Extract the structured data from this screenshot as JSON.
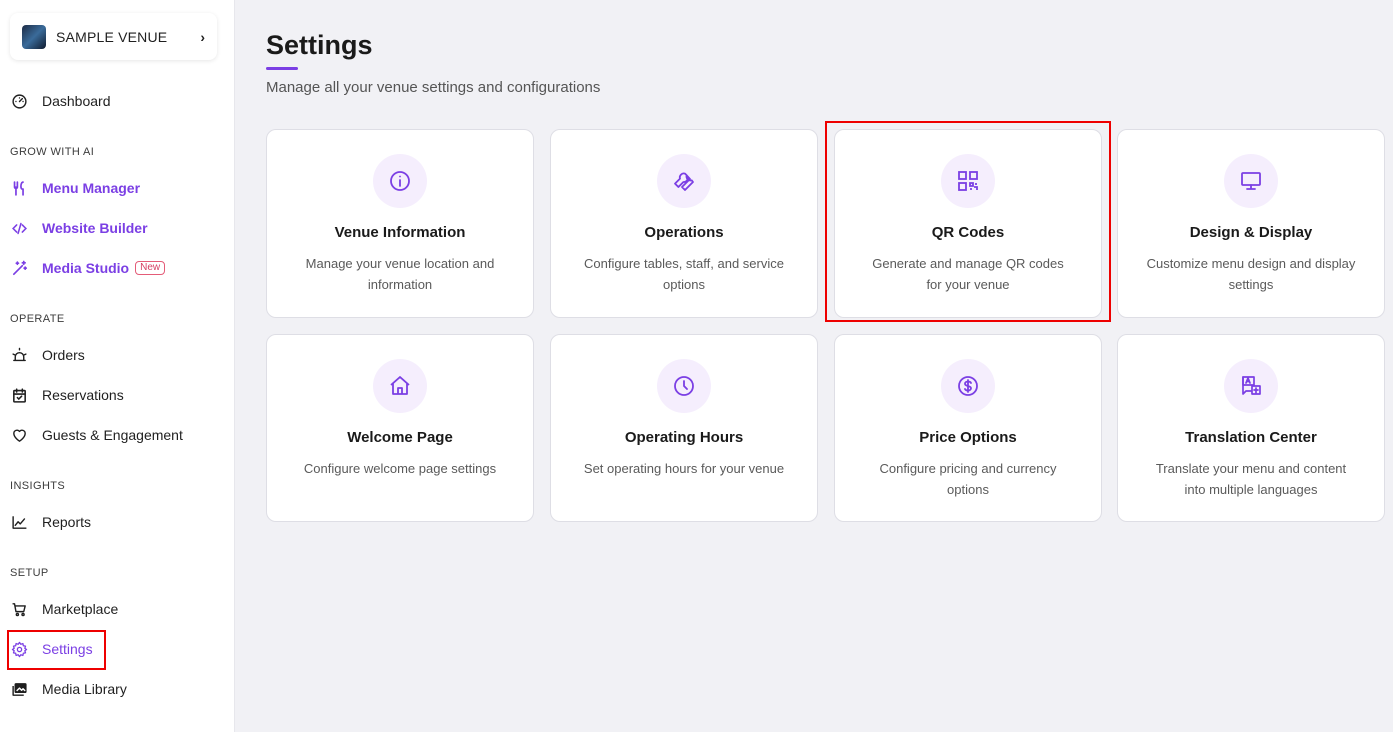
{
  "venue": {
    "name": "SAMPLE VENUE",
    "chevron": "›"
  },
  "sidebar": {
    "dashboard": "Dashboard",
    "sections": {
      "grow": "GROW WITH AI",
      "operate": "OPERATE",
      "insights": "INSIGHTS",
      "setup": "SETUP"
    },
    "grow_items": [
      {
        "label": "Menu Manager",
        "icon": "fork-knife-icon"
      },
      {
        "label": "Website Builder",
        "icon": "code-icon"
      },
      {
        "label": "Media Studio",
        "icon": "magic-wand-icon",
        "badge": "New"
      }
    ],
    "operate_items": [
      {
        "label": "Orders",
        "icon": "bell-icon"
      },
      {
        "label": "Reservations",
        "icon": "calendar-check-icon"
      },
      {
        "label": "Guests & Engagement",
        "icon": "heart-icon"
      }
    ],
    "insights_items": [
      {
        "label": "Reports",
        "icon": "line-chart-icon"
      }
    ],
    "setup_items": [
      {
        "label": "Marketplace",
        "icon": "cart-icon"
      },
      {
        "label": "Settings",
        "icon": "gear-icon",
        "active": true
      },
      {
        "label": "Media Library",
        "icon": "images-icon"
      }
    ]
  },
  "main": {
    "title": "Settings",
    "subtitle": "Manage all your venue settings and configurations",
    "cards": [
      {
        "title": "Venue Information",
        "desc": "Manage your venue location and information",
        "icon": "info-icon"
      },
      {
        "title": "Operations",
        "desc": "Configure tables, staff, and service options",
        "icon": "wrench-icon"
      },
      {
        "title": "QR Codes",
        "desc": "Generate and manage QR codes for your venue",
        "icon": "qr-code-icon"
      },
      {
        "title": "Design & Display",
        "desc": "Customize menu design and display settings",
        "icon": "monitor-icon"
      },
      {
        "title": "Welcome Page",
        "desc": "Configure welcome page settings",
        "icon": "home-icon"
      },
      {
        "title": "Operating Hours",
        "desc": "Set operating hours for your venue",
        "icon": "clock-icon"
      },
      {
        "title": "Price Options",
        "desc": "Configure pricing and currency options",
        "icon": "dollar-icon"
      },
      {
        "title": "Translation Center",
        "desc": "Translate your menu and content into multiple languages",
        "icon": "translate-icon"
      }
    ]
  },
  "colors": {
    "accent": "#7b3fe4",
    "icon_bg": "#f5eefd",
    "highlight": "#e00000",
    "badge": "#d63f63"
  }
}
